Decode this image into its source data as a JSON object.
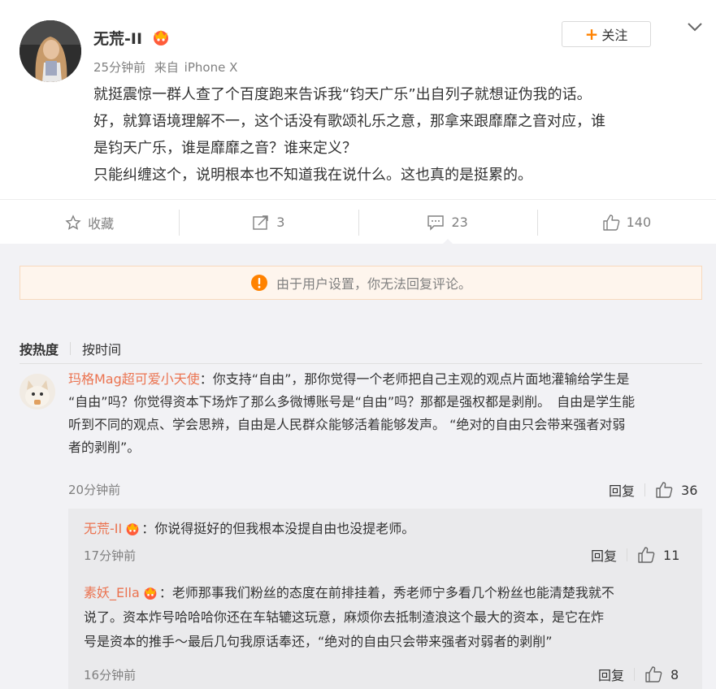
{
  "post": {
    "author": "无荒-II",
    "time": "25分钟前",
    "source_prefix": "来自",
    "source": "iPhone X",
    "follow_label": "关注",
    "text_lines": [
      "就挺震惊一群人查了个百度跑来告诉我“钧天广乐”出自列子就想证伪我的话。",
      "好，就算语境理解不一，这个话没有歌颂礼乐之意，那拿来跟靡靡之音对应，谁",
      "是钧天广乐，谁是靡靡之音？谁来定义？",
      "只能纠缠这个，说明根本也不知道我在说什么。这也真的是挺累的。"
    ]
  },
  "actions": {
    "favorite_label": "收藏",
    "repost_count": "3",
    "comment_count": "23",
    "like_count": "140"
  },
  "notice": {
    "text": "由于用户设置，你无法回复评论。"
  },
  "sort": {
    "hot": "按热度",
    "time": "按时间"
  },
  "comment": {
    "user": "玛格Mag超可爱小天使",
    "lines": [
      "：你支持“自由”，那你觉得一个老师把自己主观的观点片面地灌输给学生是",
      "“自由”吗？你觉得资本下场炸了那么多微博账号是“自由”吗？那都是强权都是剥削。　自由是学生能",
      "听到不同的观点、学会思辨，自由是人民群众能够活着能够发声。 “绝对的自由只会带来强者对弱",
      "者的剥削”。"
    ],
    "time": "20分钟前",
    "reply_label": "回复",
    "likes": "36"
  },
  "replies": [
    {
      "user": "无荒-II",
      "lines": [
        "：你说得挺好的但我根本没提自由也没提老师。"
      ],
      "time": "17分钟前",
      "reply_label": "回复",
      "likes": "11"
    },
    {
      "user": "素妖_Ella",
      "lines": [
        "：老师那事我们粉丝的态度在前排挂着，秀老师宁多看几个粉丝也能清楚我就不",
        "说了。资本炸号哈哈哈你还在车轱辘这玩意，麻烦你去抵制渣浪这个最大的资本，是它在炸",
        "号是资本的推手～最后几句我原话奉还，“绝对的自由只会带来强者对弱者的剥削”"
      ],
      "time": "16分钟前",
      "reply_label": "回复",
      "likes": "8"
    }
  ],
  "colors": {
    "accent": "#ff8200",
    "username": "#eb7350",
    "muted": "#808080",
    "notice_bg": "#fef5ed"
  }
}
